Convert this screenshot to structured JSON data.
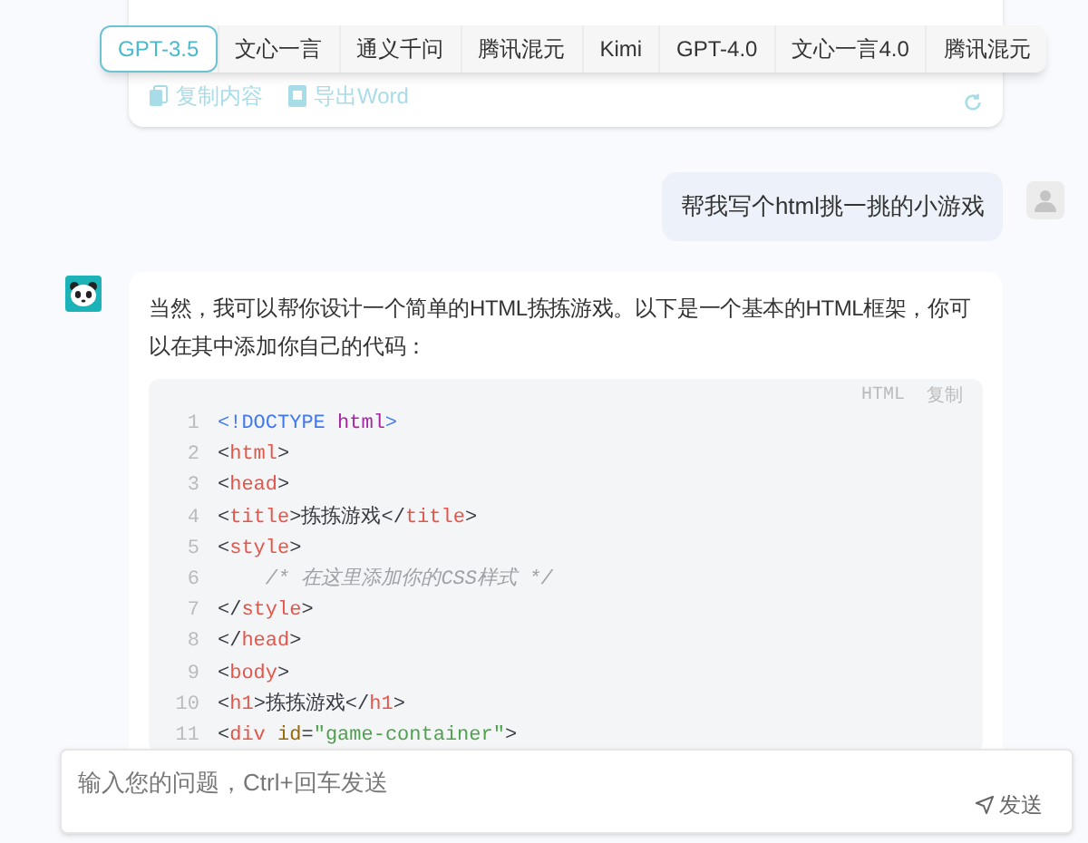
{
  "model_tabs": [
    {
      "label": "GPT-3.5",
      "selected": true
    },
    {
      "label": "文心一言",
      "selected": false
    },
    {
      "label": "通义千问",
      "selected": false
    },
    {
      "label": "腾讯混元",
      "selected": false
    },
    {
      "label": "Kimi",
      "selected": false
    },
    {
      "label": "GPT-4.0",
      "selected": false
    },
    {
      "label": "文心一言4.0",
      "selected": false
    },
    {
      "label": "腾讯混元",
      "selected": false
    }
  ],
  "previous_answer": {
    "actions": [
      {
        "kind": "copy",
        "label": "复制内容"
      },
      {
        "kind": "word",
        "label": "导出Word"
      }
    ]
  },
  "user_message": "帮我写个html挑一挑的小游戏",
  "answer": {
    "text": "当然，我可以帮你设计一个简单的HTML拣拣游戏。以下是一个基本的HTML框架，你可以在其中添加你自己的代码：",
    "code": {
      "language": "HTML",
      "copy_label": "复制",
      "lines": [
        {
          "number": "1",
          "tokens": [
            {
              "kind": "doctype",
              "text": "<!DOCTYPE "
            },
            {
              "kind": "keyword",
              "text": "html"
            },
            {
              "kind": "doctype",
              "text": ">"
            }
          ]
        },
        {
          "number": "2",
          "tokens": [
            {
              "kind": "punct",
              "text": "<"
            },
            {
              "kind": "tag",
              "text": "html"
            },
            {
              "kind": "punct",
              "text": ">"
            }
          ]
        },
        {
          "number": "3",
          "tokens": [
            {
              "kind": "punct",
              "text": "<"
            },
            {
              "kind": "tag",
              "text": "head"
            },
            {
              "kind": "punct",
              "text": ">"
            }
          ]
        },
        {
          "number": "4",
          "tokens": [
            {
              "kind": "punct",
              "text": "<"
            },
            {
              "kind": "tag",
              "text": "title"
            },
            {
              "kind": "punct",
              "text": ">"
            },
            {
              "kind": "text",
              "text": "拣拣游戏"
            },
            {
              "kind": "punct",
              "text": "</"
            },
            {
              "kind": "tag",
              "text": "title"
            },
            {
              "kind": "punct",
              "text": ">"
            }
          ]
        },
        {
          "number": "5",
          "tokens": [
            {
              "kind": "punct",
              "text": "<"
            },
            {
              "kind": "tag",
              "text": "style"
            },
            {
              "kind": "punct",
              "text": ">"
            }
          ]
        },
        {
          "number": "6",
          "tokens": [
            {
              "kind": "comment",
              "text": "    /* 在这里添加你的CSS样式 */"
            }
          ]
        },
        {
          "number": "7",
          "tokens": [
            {
              "kind": "punct",
              "text": "</"
            },
            {
              "kind": "tag",
              "text": "style"
            },
            {
              "kind": "punct",
              "text": ">"
            }
          ]
        },
        {
          "number": "8",
          "tokens": [
            {
              "kind": "punct",
              "text": "</"
            },
            {
              "kind": "tag",
              "text": "head"
            },
            {
              "kind": "punct",
              "text": ">"
            }
          ]
        },
        {
          "number": "9",
          "tokens": [
            {
              "kind": "punct",
              "text": "<"
            },
            {
              "kind": "tag",
              "text": "body"
            },
            {
              "kind": "punct",
              "text": ">"
            }
          ]
        },
        {
          "number": "10",
          "tokens": [
            {
              "kind": "punct",
              "text": "<"
            },
            {
              "kind": "tag",
              "text": "h1"
            },
            {
              "kind": "punct",
              "text": ">"
            },
            {
              "kind": "text",
              "text": "拣拣游戏"
            },
            {
              "kind": "punct",
              "text": "</"
            },
            {
              "kind": "tag",
              "text": "h1"
            },
            {
              "kind": "punct",
              "text": ">"
            }
          ]
        },
        {
          "number": "11",
          "tokens": [
            {
              "kind": "punct",
              "text": "<"
            },
            {
              "kind": "tag",
              "text": "div"
            },
            {
              "kind": "attr",
              "text": " id"
            },
            {
              "kind": "punct",
              "text": "="
            },
            {
              "kind": "string",
              "text": "\"game-container\""
            },
            {
              "kind": "punct",
              "text": ">"
            }
          ]
        }
      ]
    }
  },
  "input": {
    "placeholder": "输入您的问题，Ctrl+回车发送",
    "send_label": "发送"
  }
}
